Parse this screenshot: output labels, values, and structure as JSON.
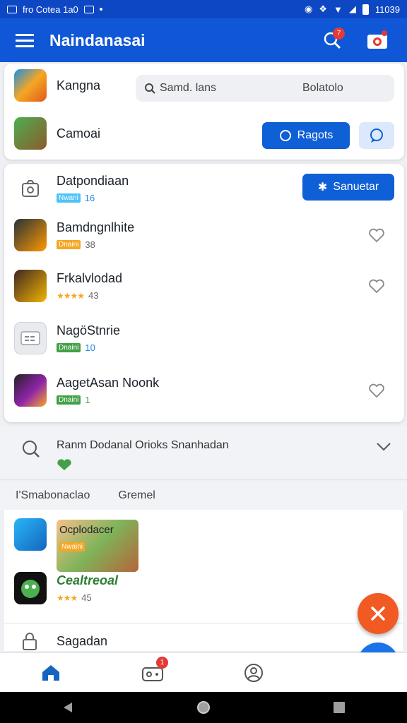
{
  "status_bar": {
    "left_text": "fro Cotea 1a0",
    "time": "11039"
  },
  "app_bar": {
    "title": "Naindanasai",
    "notification_count": "7"
  },
  "top_card": {
    "row1_name": "Kangna",
    "search_placeholder": "Samd. lans",
    "search_secondary": "Bolatolo",
    "row2_name": "Camoai",
    "primary_button_label": "Ragots"
  },
  "list_card": {
    "header_name": "Datpondiaan",
    "header_tag": "Nwani",
    "header_count": "16",
    "header_button_label": "Sanuetar",
    "items": [
      {
        "name": "Bamdngnlhite",
        "tag": "Dnaini",
        "count": "38"
      },
      {
        "name": "Frkalvlodad",
        "stars": "★★★★",
        "count": "43"
      },
      {
        "name": "NagöStnrie",
        "tag": "Dnaini",
        "count": "10"
      },
      {
        "name": "AagetAsan Noonk",
        "tag": "Dnaini",
        "count": "1"
      }
    ]
  },
  "expander": {
    "label": "Ranm Dodanal Orioks Snanhadan"
  },
  "tabs": {
    "tab1": "I'Smabonaclao",
    "tab2": "Gremel"
  },
  "bottom_card": {
    "item1_name": "Ocplodacer",
    "item1_tag": "Nwaini",
    "item2_name": "Cealtreoal",
    "item2_stars": "★★★",
    "item2_count": "45",
    "item3_name": "Sagadan"
  },
  "bottom_nav": {
    "badge_count": "1"
  },
  "colors": {
    "primary": "#0f57d6",
    "fab_orange": "#f15a22",
    "fab_blue": "#1a73e8"
  }
}
